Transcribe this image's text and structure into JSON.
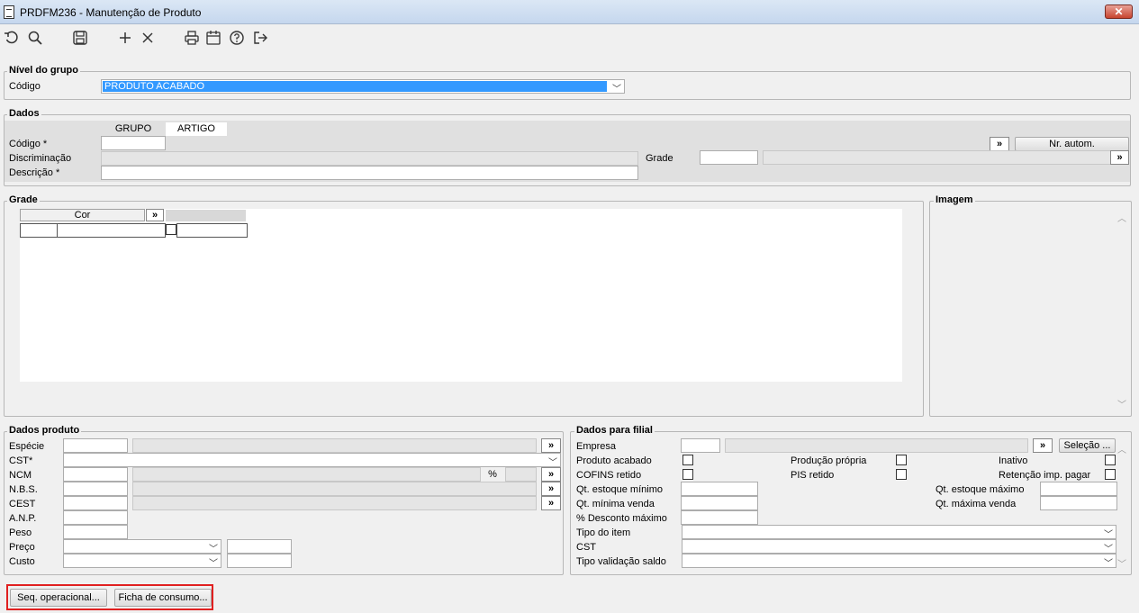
{
  "window": {
    "title": "PRDFM236 - Manutenção de Produto",
    "close_label": "✕"
  },
  "toolbar": {
    "icons": [
      "undo-icon",
      "search-icon",
      "save-icon",
      "add-icon",
      "delete-icon",
      "print-icon",
      "calendar-icon",
      "help-icon",
      "exit-icon"
    ]
  },
  "nivel": {
    "legend": "Nível do grupo",
    "codigo_label": "Código",
    "codigo_value": "PRODUTO ACABADO"
  },
  "dados": {
    "legend": "Dados",
    "tab_grupo": "GRUPO",
    "tab_artigo": "ARTIGO",
    "codigo_label": "Código *",
    "discriminacao_label": "Discriminação",
    "descricao_label": "Descrição *",
    "grade_label": "Grade",
    "lookup": "»",
    "nr_autom": "Nr. autom."
  },
  "grade": {
    "legend": "Grade",
    "col_cor": "Cor",
    "lookup": "»"
  },
  "imagem": {
    "legend": "Imagem",
    "scroll_up": "︿",
    "scroll_down": "﹀"
  },
  "produto": {
    "legend": "Dados produto",
    "especie": "Espécie",
    "cst": "CST*",
    "ncm": "NCM",
    "nbs": "N.B.S.",
    "cest": "CEST",
    "anp": "A.N.P.",
    "peso": "Peso",
    "preco": "Preço",
    "custo": "Custo",
    "percent": "%",
    "lookup": "»"
  },
  "filial": {
    "legend": "Dados para filial",
    "empresa": "Empresa",
    "selecao": "Seleção ...",
    "produto_acabado": "Produto acabado",
    "producao_propria": "Produção própria",
    "inativo": "Inativo",
    "cofins": "COFINS retido",
    "pis": "PIS retido",
    "retencao": "Retenção imp. pagar",
    "qt_est_min": "Qt. estoque mínimo",
    "qt_est_max": "Qt. estoque máximo",
    "qt_min_venda": "Qt. mínima venda",
    "qt_max_venda": "Qt. máxima venda",
    "desconto": "% Desconto máximo",
    "tipo_item": "Tipo do item",
    "cst": "CST",
    "tipo_validacao": "Tipo validação saldo",
    "lookup": "»"
  },
  "footer": {
    "seq": "Seq. operacional...",
    "ficha": "Ficha de consumo..."
  },
  "accent": {
    "selection": "#3399ff",
    "highlight_border": "#e02020"
  }
}
